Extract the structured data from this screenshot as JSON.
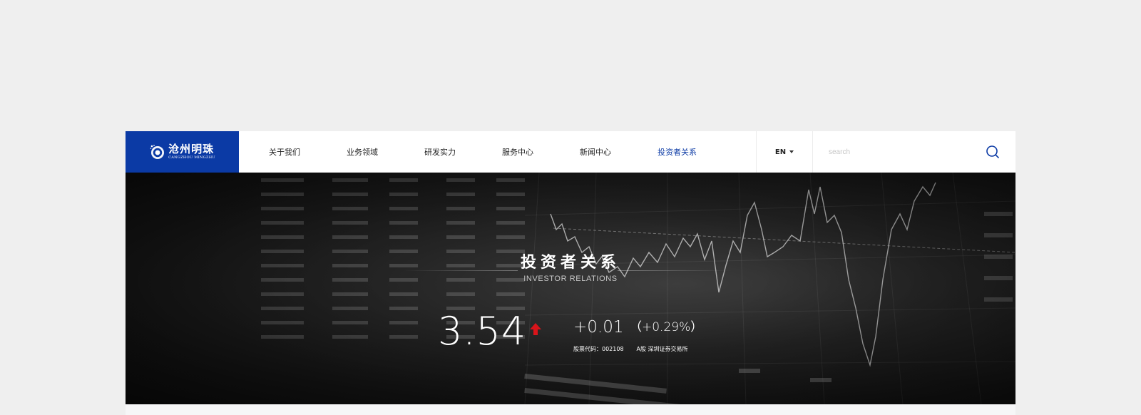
{
  "logo": {
    "cn": "沧州明珠",
    "en": "CANGZHOU MINGZHU"
  },
  "nav": {
    "items": [
      {
        "label": "关于我们"
      },
      {
        "label": "业务领域"
      },
      {
        "label": "研发实力"
      },
      {
        "label": "服务中心"
      },
      {
        "label": "新闻中心"
      },
      {
        "label": "投资者关系",
        "active": true
      }
    ]
  },
  "lang": {
    "label": "EN"
  },
  "search": {
    "placeholder": "search",
    "value": ""
  },
  "banner": {
    "title_cn": "投资者关系",
    "title_en": "INVESTOR RELATIONS",
    "price": "3.54",
    "change": "+0.01",
    "change_pct": "（+0.29%）",
    "stock_code_label": "股票代码：002108",
    "market_label": "A股 深圳证券交易所"
  },
  "colors": {
    "brand": "#0b3aa5",
    "up": "#d8141a",
    "active_nav": "#0b3aa5",
    "page_bg": "#efefef"
  },
  "icons": {
    "search": "search-icon",
    "caret": "caret-down-icon",
    "arrow": "up-arrow-icon"
  }
}
